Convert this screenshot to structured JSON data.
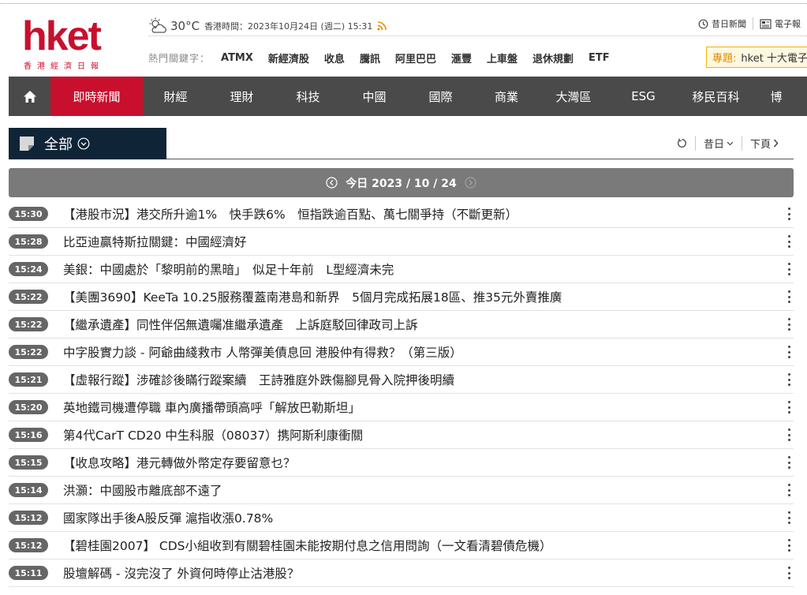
{
  "header": {
    "logo_text": "hket",
    "logo_subtitle": "香港經濟日報",
    "temperature": "30°C",
    "datetime": "香港時間：2023年10月24日 (週二) 15:31",
    "links": [
      {
        "label": "昔日新聞",
        "icon": "history-icon"
      },
      {
        "label": "電子報",
        "icon": "newspaper-icon"
      }
    ],
    "hot_label": "熱門關鍵字：",
    "hot_keywords": [
      "ATMX",
      "新經濟股",
      "收息",
      "騰訊",
      "阿里巴巴",
      "滙豐",
      "上車盤",
      "退休規劃",
      "ETF"
    ],
    "topic": {
      "key": "專題:",
      "text": "hket 十大電子"
    }
  },
  "nav": {
    "items": [
      "即時新聞",
      "財經",
      "理財",
      "科技",
      "中國",
      "國際",
      "商業",
      "大灣區",
      "ESG",
      "移民百科",
      "博"
    ],
    "active_index": 0
  },
  "section": {
    "label": "全部",
    "pager": {
      "prev_day": "昔日",
      "next_page": "下頁"
    }
  },
  "date_bar": {
    "text": "今日 2023 / 10 / 24"
  },
  "news": [
    {
      "time": "15:30",
      "title": "【港股市況】港交所升逾1%　快手跌6%　恒指跌逾百點、萬七關爭持（不斷更新）"
    },
    {
      "time": "15:28",
      "title": "比亞迪贏特斯拉關鍵：中國經濟好"
    },
    {
      "time": "15:24",
      "title": "美銀：中國處於「黎明前的黑暗」　似足十年前　L型經濟未完"
    },
    {
      "time": "15:22",
      "title": "【美團3690】KeeTa 10.25服務覆蓋南港島和新界　5個月完成拓展18區、推35元外賣推廣"
    },
    {
      "time": "15:22",
      "title": "【繼承遺產】同性伴侶無遺囑准繼承遺產　上訴庭駁回律政司上訴"
    },
    {
      "time": "15:22",
      "title": "中字股實力談 - 阿爺曲綫救市 人幣彈美債息回 港股仲有得救？（第三版）"
    },
    {
      "time": "15:21",
      "title": "【虛報行蹤】涉確診後瞞行蹤案續　王詩雅庭外跌傷腳見骨入院押後明續"
    },
    {
      "time": "15:20",
      "title": "英地鐵司機遭停職 車內廣播帶頭高呼「解放巴勒斯坦」"
    },
    {
      "time": "15:16",
      "title": "第4代CarT CD20 中生科服（08037）携阿斯利康衝關"
    },
    {
      "time": "15:15",
      "title": "【收息攻略】港元轉做外幣定存要留意乜？"
    },
    {
      "time": "15:14",
      "title": "洪灝：中國股市離底部不遠了"
    },
    {
      "time": "15:12",
      "title": "國家隊出手後A股反彈 滬指收漲0.78%"
    },
    {
      "time": "15:12",
      "title": "【碧桂園2007】 CDS小組收到有關碧桂園未能按期付息之信用問詢（一文看清碧債危機）"
    },
    {
      "time": "15:11",
      "title": "股壇解碼 - 沒完沒了 外資何時停止沽港股？"
    }
  ]
}
